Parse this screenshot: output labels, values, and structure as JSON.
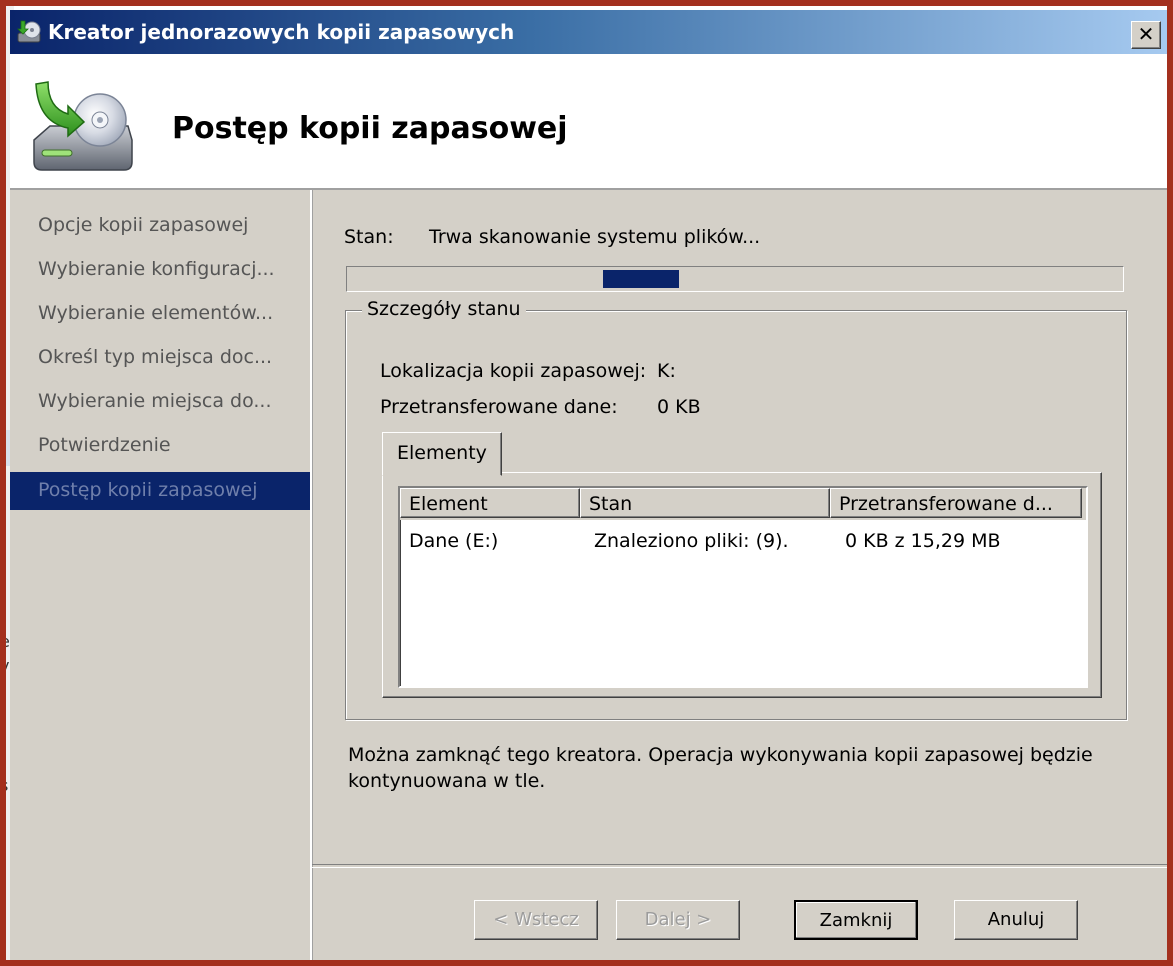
{
  "window": {
    "title": "Kreator jednorazowych kopii zapasowych",
    "close_glyph": "✕"
  },
  "header": {
    "title": "Postęp kopii zapasowej",
    "icon": "backup-disk-icon"
  },
  "sidebar": {
    "items": [
      {
        "label": "Opcje kopii zapasowej"
      },
      {
        "label": "Wybieranie konfiguracj..."
      },
      {
        "label": "Wybieranie elementów..."
      },
      {
        "label": "Określ typ miejsca doc..."
      },
      {
        "label": "Wybieranie miejsca do..."
      },
      {
        "label": "Potwierdzenie"
      },
      {
        "label": "Postęp kopii zapasowej",
        "active": true
      }
    ]
  },
  "status": {
    "label": "Stan:",
    "value": "Trwa skanowanie systemu plików..."
  },
  "details": {
    "group_title": "Szczegóły stanu",
    "location_label": "Lokalizacja kopii zapasowej:",
    "location_value": "K:",
    "transferred_label": "Przetransferowane dane:",
    "transferred_value": "0 KB",
    "tab_label": "Elementy",
    "columns": [
      "Element",
      "Stan",
      "Przetransferowane d..."
    ],
    "rows": [
      [
        "Dane (E:)",
        "Znaleziono pliki: (9).",
        "0 KB z 15,29 MB"
      ]
    ]
  },
  "note": "Można zamknąć tego kreatora. Operacja wykonywania kopii zapasowej będzie kontynuowana w tle.",
  "buttons": {
    "back": "< Wstecz",
    "next": "Dalej >",
    "close": "Zamknij",
    "cancel": "Anuluj"
  },
  "colors": {
    "frame": "#a4301e",
    "selection": "#0a246a",
    "face": "#d4d0c8"
  }
}
